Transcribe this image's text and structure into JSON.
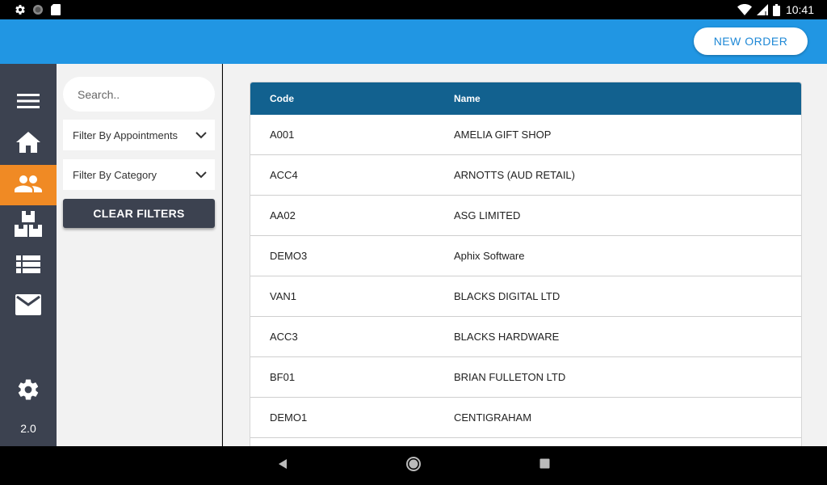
{
  "status_bar": {
    "time": "10:41",
    "left_icons": [
      "settings-icon",
      "circle-icon",
      "sd-card-icon"
    ],
    "right_icons": [
      "wifi-icon",
      "signal-icon",
      "battery-icon"
    ]
  },
  "appbar": {
    "new_order_label": "NEW ORDER",
    "color": "#2196e3"
  },
  "nav_rail": {
    "items": [
      {
        "icon": "menu-icon",
        "active": false
      },
      {
        "icon": "home-icon",
        "active": false
      },
      {
        "icon": "customers-icon",
        "active": true
      },
      {
        "icon": "products-icon",
        "active": false
      },
      {
        "icon": "list-icon",
        "active": false
      },
      {
        "icon": "mail-icon",
        "active": false
      },
      {
        "icon": "settings-icon",
        "active": false
      }
    ],
    "version": "2.0",
    "active_color": "#f08a24"
  },
  "filters": {
    "search_placeholder": "Search..",
    "search_value": "",
    "filter_appointments": "Filter By Appointments",
    "filter_category": "Filter By Category",
    "clear_label": "CLEAR FILTERS"
  },
  "table": {
    "headers": {
      "code": "Code",
      "name": "Name"
    },
    "rows": [
      {
        "code": "A001",
        "name": "AMELIA GIFT SHOP"
      },
      {
        "code": "ACC4",
        "name": "ARNOTTS (AUD RETAIL)"
      },
      {
        "code": "AA02",
        "name": "ASG LIMITED"
      },
      {
        "code": "DEMO3",
        "name": "Aphix Software"
      },
      {
        "code": "VAN1",
        "name": "BLACKS DIGITAL LTD"
      },
      {
        "code": "ACC3",
        "name": "BLACKS HARDWARE"
      },
      {
        "code": "BF01",
        "name": "BRIAN FULLETON LTD"
      },
      {
        "code": "DEMO1",
        "name": "CENTIGRAHAM"
      },
      {
        "code": "",
        "name": ""
      }
    ],
    "header_color": "#12618f"
  },
  "system_nav": {
    "buttons": [
      "back-icon",
      "home-circle-icon",
      "recents-icon"
    ]
  }
}
